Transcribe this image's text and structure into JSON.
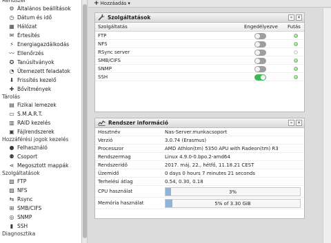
{
  "sidebar": {
    "sections": [
      {
        "label": "Rendszer",
        "items": [
          {
            "label": "Általános beállítások",
            "icon": "gears-icon"
          },
          {
            "label": "Dátum és idő",
            "icon": "clock-icon"
          },
          {
            "label": "Hálózat",
            "icon": "network-icon"
          },
          {
            "label": "Értesítés",
            "icon": "envelope-icon"
          },
          {
            "label": "Energiagazdálkodás",
            "icon": "power-icon"
          },
          {
            "label": "Ellenőrzés",
            "icon": "chart-line-icon"
          },
          {
            "label": "Tanúsítványok",
            "icon": "certificate-icon"
          },
          {
            "label": "Ütemezett feladatok",
            "icon": "alarm-clock-icon"
          },
          {
            "label": "Frissítés kezelő",
            "icon": "download-icon"
          },
          {
            "label": "Bővítmények",
            "icon": "puzzle-icon"
          }
        ]
      },
      {
        "label": "Tárolás",
        "items": [
          {
            "label": "Fizikai lemezek",
            "icon": "disk-icon"
          },
          {
            "label": "S.M.A.R.T.",
            "icon": "monitor-icon"
          },
          {
            "label": "RAID kezelés",
            "icon": "raid-icon"
          },
          {
            "label": "Fájlrendszerek",
            "icon": "filesystem-icon"
          }
        ]
      },
      {
        "label": "Hozzáférési jogok kezelés",
        "items": [
          {
            "label": "Felhasználó",
            "icon": "user-icon"
          },
          {
            "label": "Csoport",
            "icon": "group-icon"
          },
          {
            "label": "Megosztott mappák",
            "icon": "share-icon"
          }
        ]
      },
      {
        "label": "Szolgáltatások",
        "items": [
          {
            "label": "FTP",
            "icon": "ftp-icon"
          },
          {
            "label": "NFS",
            "icon": "nfs-icon"
          },
          {
            "label": "Rsync",
            "icon": "rsync-icon"
          },
          {
            "label": "SMB/CIFS",
            "icon": "windows-icon"
          },
          {
            "label": "SNMP",
            "icon": "snmp-icon"
          },
          {
            "label": "SSH",
            "icon": "terminal-icon"
          }
        ]
      },
      {
        "label": "Diagnosztika",
        "items": []
      }
    ]
  },
  "toolbar": {
    "add_label": "Hozzáadás",
    "add_caret": "▾"
  },
  "services_widget": {
    "title": "Szolgáltatások",
    "btn_collapse": "«",
    "btn_close": "✕",
    "columns": {
      "name": "Szolgáltatás",
      "enabled": "Engedélyezve",
      "running": "Futás"
    },
    "rows": [
      {
        "name": "FTP",
        "enabled": false,
        "running": true
      },
      {
        "name": "NFS",
        "enabled": false,
        "running": true
      },
      {
        "name": "RSync server",
        "enabled": false,
        "running": false
      },
      {
        "name": "SMB/CIFS",
        "enabled": false,
        "running": true
      },
      {
        "name": "SNMP",
        "enabled": false,
        "running": true
      },
      {
        "name": "SSH",
        "enabled": true,
        "running": true
      }
    ]
  },
  "sysinfo_widget": {
    "title": "Rendszer információ",
    "btn_collapse": "«",
    "btn_close": "✕",
    "rows": [
      {
        "key": "Hosztnév",
        "value": "Nas-Server.munkacsoport"
      },
      {
        "key": "Verzió",
        "value": "3.0.74 (Erasmus)"
      },
      {
        "key": "Processzor",
        "value": "AMD Athlon(tm) 5350 APU with Radeon(tm) R3"
      },
      {
        "key": "Rendszermag",
        "value": "Linux 4.9.0-0.bpo.2-amd64"
      },
      {
        "key": "Rendszeridő",
        "value": "2017. máj. 22., hétfő, 11.18.21 CEST"
      },
      {
        "key": "Üzemidő",
        "value": "0 days 0 hours 7 minutes 21 seconds"
      },
      {
        "key": "Terhelési átlag",
        "value": "0.54, 0.30, 0.18"
      }
    ],
    "cpu": {
      "key": "CPU használat",
      "label": "3%",
      "fraction": 0.03
    },
    "memory": {
      "key": "Memória használat",
      "label": "5% of 3.30 GiB",
      "fraction": 0.05
    }
  },
  "colors": {
    "toggle_on": "#3cb856",
    "toggle_off": "#9e9e9e",
    "running_dot": "#7bc26a",
    "bar_fill": "#8fb4d8"
  }
}
